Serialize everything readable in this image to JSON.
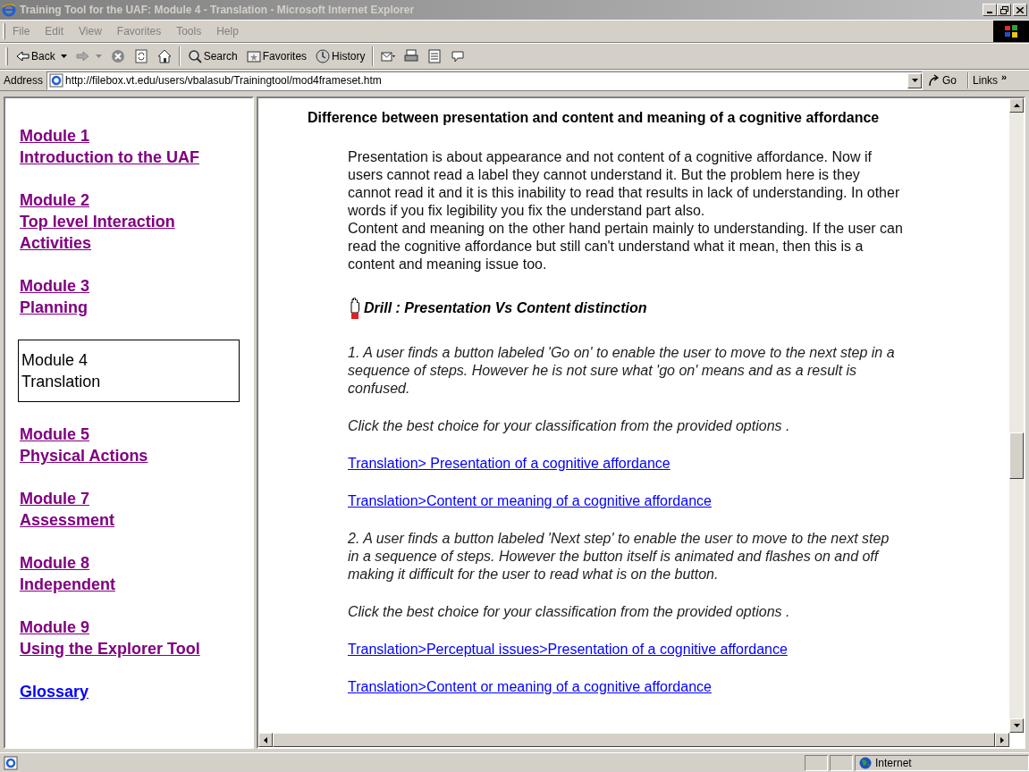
{
  "window": {
    "title": "Training Tool for the UAF: Module 4 - Translation - Microsoft Internet Explorer"
  },
  "menu": [
    "File",
    "Edit",
    "View",
    "Favorites",
    "Tools",
    "Help"
  ],
  "toolbar": [
    {
      "kind": "back",
      "label": "Back"
    },
    {
      "kind": "forward"
    },
    {
      "kind": "stop"
    },
    {
      "kind": "refresh"
    },
    {
      "kind": "home"
    },
    {
      "kind": "search",
      "label": "Search"
    },
    {
      "kind": "favorites",
      "label": "Favorites"
    },
    {
      "kind": "history",
      "label": "History"
    },
    {
      "kind": "mail"
    },
    {
      "kind": "print"
    },
    {
      "kind": "edit"
    },
    {
      "kind": "discuss"
    }
  ],
  "address": {
    "label": "Address",
    "value": "http://filebox.vt.edu/users/vbalasub/Trainingtool/mod4frameset.htm",
    "go": "Go",
    "links": "Links",
    "more": "»"
  },
  "nav": [
    {
      "lines": [
        "Module 1",
        "Introduction to the UAF"
      ],
      "selected": false,
      "visited": true
    },
    {
      "lines": [
        "Module 2",
        "Top level Interaction",
        "Activities"
      ],
      "selected": false,
      "visited": true
    },
    {
      "lines": [
        "Module 3",
        "Planning"
      ],
      "selected": false,
      "visited": true
    },
    {
      "lines": [
        "Module 4",
        "Translation"
      ],
      "selected": true
    },
    {
      "lines": [
        "Module 5",
        "Physical Actions"
      ],
      "selected": false,
      "visited": true
    },
    {
      "lines": [
        "Module 7",
        "Assessment"
      ],
      "selected": false,
      "visited": true
    },
    {
      "lines": [
        "Module 8",
        "Independent"
      ],
      "selected": false,
      "visited": true
    },
    {
      "lines": [
        "Module 9",
        "Using the Explorer Tool"
      ],
      "selected": false,
      "visited": true
    },
    {
      "lines": [
        "Glossary"
      ],
      "selected": false,
      "visited": false
    }
  ],
  "content": [
    {
      "kind": "heading",
      "text": "Difference between presentation and content and meaning of a cognitive affordance"
    },
    {
      "kind": "paragraph",
      "text": "Presentation is about appearance and not content of a cognitive affordance. Now if users cannot read a label they cannot understand it. But the problem here is they cannot read it and it is this inability to read that results in lack of understanding. In other words if you fix legibility you fix the understand part also."
    },
    {
      "kind": "paragraph",
      "text": "Content and meaning on the other hand pertain mainly to understanding. If the user can read the cognitive affordance but still can't understand what it mean, then this is a content and meaning issue too."
    },
    {
      "kind": "drill",
      "text": "Drill : Presentation Vs Content distinction"
    },
    {
      "kind": "question",
      "text": "1. A user finds a button labeled 'Go on' to enable the user to move to the next step in a sequence of steps. However he is not sure what 'go on' means and as a result is confused."
    },
    {
      "kind": "question",
      "text": "Click the best choice for your classification from the provided options ."
    },
    {
      "kind": "link",
      "text": "Translation> Presentation of a cognitive affordance"
    },
    {
      "kind": "link",
      "text": "Translation>Content or meaning of a cognitive affordance"
    },
    {
      "kind": "question",
      "text": "2. A user finds a button labeled 'Next step' to enable the user to move to the next step in a sequence of steps. However the button itself is animated and flashes on and off making it difficult for the user to read what is on the button."
    },
    {
      "kind": "question",
      "text": "Click the best choice for your classification from the provided options ."
    },
    {
      "kind": "link",
      "text": "Translation>Perceptual issues>Presentation of a cognitive affordance"
    },
    {
      "kind": "link",
      "text": "Translation>Content or meaning of a cognitive affordance"
    }
  ],
  "status_bar": {
    "zone": "Internet"
  }
}
